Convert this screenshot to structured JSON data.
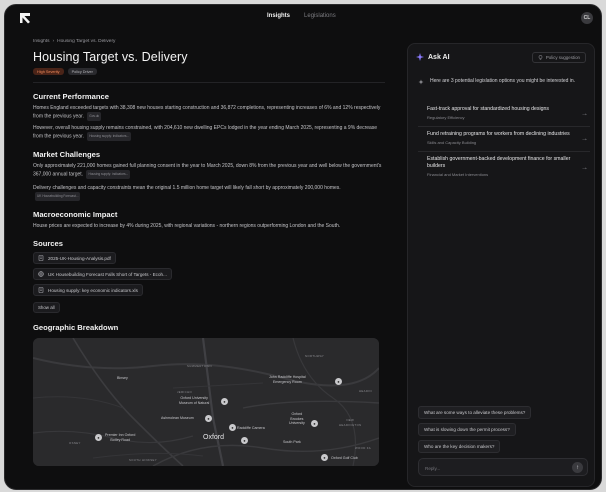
{
  "topbar": {
    "logo_icon": "arrow-logo-icon",
    "tabs": [
      {
        "label": "Insights",
        "active": true
      },
      {
        "label": "Legislations",
        "active": false
      }
    ],
    "avatar_initials": "CL"
  },
  "main": {
    "breadcrumb": {
      "root": "Insights",
      "separator": "›",
      "current": "Housing Target vs. Delivery"
    },
    "title": "Housing Target vs. Delivery",
    "badges": {
      "severity": "High Severity",
      "policy": "Policy Driver"
    },
    "sections": {
      "current_performance": {
        "heading": "Current Performance",
        "p1": "Homes England exceeded targets with 38,308 new houses starting construction and 36,872 completions, representing increases of 6% and 12% respectively from the previous year.",
        "p1_chip": "Gov.uk",
        "p2": "However, overall housing supply remains constrained, with 204,610 new dwelling EPCs lodged in the year ending March 2025, representing a 9% decrease from the previous year.",
        "p2_chip": "Housing supply: indicators..."
      },
      "market_challenges": {
        "heading": "Market Challenges",
        "p1": "Only approximately 221,000 homes gained full planning consent in the year to March 2025, down 8% from the previous year and well below the government's 367,000 annual target.",
        "p1_chip": "Housing supply: indicators...",
        "p2": "Delivery challenges and capacity constraints mean the original 1.5 million home target will likely fall short by approximately 200,000 homes.",
        "p2_chip": "UK Housebuilding Forecast..."
      },
      "macroeconomic": {
        "heading": "Macroeconomic Impact",
        "p1": "House prices are expected to increase by 4% during 2025, with regional variations - northern regions outperforming London and the South."
      },
      "sources": {
        "heading": "Sources",
        "items": [
          {
            "icon": "document-icon",
            "label": "2025-UK-Housing-Analysis.pdf"
          },
          {
            "icon": "globe-icon",
            "label": "UK Housebuilding Forecast Falls Short of Targets - Ecoh..."
          },
          {
            "icon": "document-icon",
            "label": "Housing supply: key economic indicators.xls"
          }
        ],
        "show_all": "Show all"
      },
      "geographic": {
        "heading": "Geographic Breakdown",
        "map_labels": {
          "binsey": "Binsey",
          "jericho": "JERICHO",
          "oxford_uni_museum": "Oxford University\nMuseum of Natural",
          "radcliffe": "John Radcliffe Hospital\nEmergency Room",
          "headington": "HEADIN",
          "ashmolean": "Ashmolean Museum",
          "radcliffe_camera": "Radcliffe Camera",
          "brookes": "Oxford\nBrookes\nUniversity",
          "new_headington": "NEW\nHEADINGTON",
          "oxford": "Oxford",
          "south_park": "South Park",
          "premier_inn": "Premier Inn Oxford\nBotley Road",
          "golf": "Oxford Golf Club",
          "summertown": "SUMMERTOWN",
          "osney": "OSNEY",
          "northway": "NORTHWAY",
          "south_hinksey": "SOUTH HINKSEY",
          "wood_farm": "WOOD FA"
        }
      }
    }
  },
  "ai_panel": {
    "title": "Ask AI",
    "policy_button": "Policy suggestion",
    "intro": "Here are 3 potential legislation options you might be interested in.",
    "suggestions": [
      {
        "title": "Fast-track approval for standardized housing designs",
        "category": "Regulatory Efficiency"
      },
      {
        "title": "Fund retraining programs for workers from declining industries",
        "category": "Skills and Capacity Building"
      },
      {
        "title": "Establish government-backed development finance for smaller builders",
        "category": "Financial and Market Interventions"
      }
    ],
    "quick_questions": [
      "What are some ways to alleviate these problems?",
      "What is slowing down the permit process?",
      "Who are the key decision makers?"
    ],
    "reply_placeholder": "Reply..."
  },
  "colors": {
    "background": "#0e0e0f",
    "panel": "#161618",
    "severity_badge": "#f08a5a"
  }
}
